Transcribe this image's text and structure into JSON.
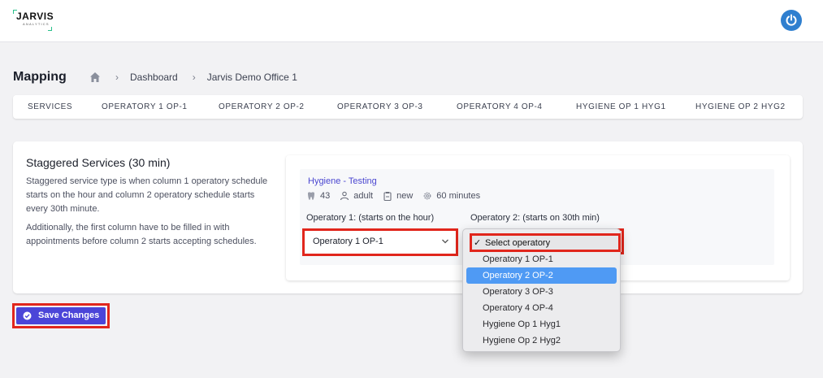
{
  "app": {
    "logo_text": "JARVIS",
    "logo_subtext": "ANALYTICS",
    "accent_color": "#4b45d8",
    "power_icon": "power-icon"
  },
  "header": {
    "title": "Mapping",
    "breadcrumb": {
      "home_icon": "home-icon",
      "items": [
        "Dashboard",
        "Jarvis Demo Office 1"
      ]
    }
  },
  "tabs": [
    "SERVICES",
    "OPERATORY 1 OP-1",
    "OPERATORY 2 OP-2",
    "OPERATORY 3 OP-3",
    "OPERATORY 4 OP-4",
    "HYGIENE OP 1 HYG1",
    "HYGIENE OP 2 HYG2"
  ],
  "staggered": {
    "title": "Staggered Services (30 min)",
    "description_1": "Staggered service type is when column 1 operatory schedule starts on the hour and column 2 operatory schedule starts every 30th minute.",
    "description_2": "Additionally, the first column have to be filled in with appointments before column 2 starts accepting schedules."
  },
  "service": {
    "name": "Hygiene - Testing",
    "code": "43",
    "patient_type": "adult",
    "status": "new",
    "duration": "60 minutes",
    "op1_label": "Operatory 1: (starts on the hour)",
    "op1_value": "Operatory 1 OP-1",
    "op2_label": "Operatory 2: (starts on 30th min)",
    "op2_value": "Select operatory"
  },
  "dropdown": {
    "checkmark": "✓",
    "selected": "Select operatory",
    "options": [
      "Operatory 1 OP-1",
      "Operatory 2 OP-2",
      "Operatory 3 OP-3",
      "Operatory 4 OP-4",
      "Hygiene Op 1 Hyg1",
      "Hygiene Op 2 Hyg2"
    ],
    "highlighted": "Operatory 2 OP-2"
  },
  "actions": {
    "save_label": "Save Changes"
  }
}
